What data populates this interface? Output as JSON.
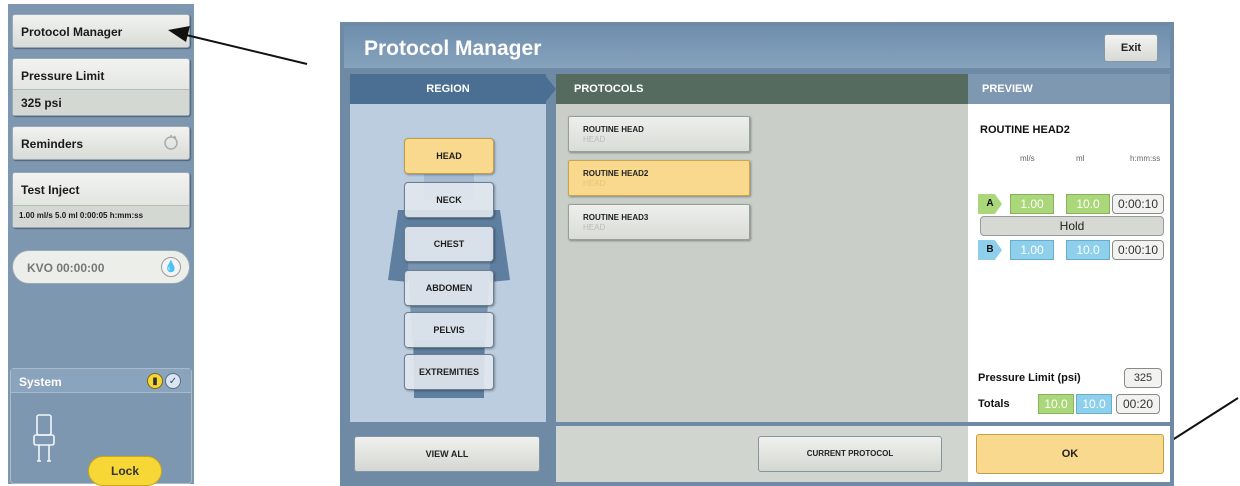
{
  "sidebar": {
    "protocol_manager_label": "Protocol Manager",
    "pressure_limit": {
      "label": "Pressure Limit",
      "value": "325 psi"
    },
    "reminders_label": "Reminders",
    "test_inject": {
      "label": "Test Inject",
      "value": "1.00 ml/s 5.0 ml 0:00:05 h:mm:ss"
    },
    "kvo_label": "KVO 00:00:00",
    "system_label": "System",
    "lock_label": "Lock"
  },
  "window": {
    "title": "Protocol Manager",
    "exit_label": "Exit"
  },
  "region": {
    "header": "REGION",
    "items": [
      "HEAD",
      "NECK",
      "CHEST",
      "ABDOMEN",
      "PELVIS",
      "EXTREMITIES"
    ],
    "selected": "HEAD",
    "view_all_label": "VIEW ALL"
  },
  "protocols": {
    "header": "PROTOCOLS",
    "items": [
      {
        "name": "ROUTINE HEAD",
        "region": "HEAD"
      },
      {
        "name": "ROUTINE HEAD2",
        "region": "HEAD"
      },
      {
        "name": "ROUTINE HEAD3",
        "region": "HEAD"
      }
    ],
    "selected": "ROUTINE HEAD2",
    "current_protocol_label": "CURRENT PROTOCOL"
  },
  "preview": {
    "header": "PREVIEW",
    "protocol_name": "ROUTINE HEAD2",
    "columns": [
      "ml/s",
      "ml",
      "h:mm:ss"
    ],
    "phases": [
      {
        "tag": "A",
        "rate": "1.00",
        "volume": "10.0",
        "duration": "0:00:10"
      },
      {
        "tag": "B",
        "rate": "1.00",
        "volume": "10.0",
        "duration": "0:00:10"
      }
    ],
    "hold_label": "Hold",
    "pressure_limit_label": "Pressure Limit (psi)",
    "pressure_limit_value": "325",
    "totals_label": "Totals",
    "totals": {
      "a": "10.0",
      "b": "10.0",
      "time": "00:20"
    },
    "ok_label": "OK"
  },
  "colors": {
    "selected": "#f8d98e",
    "phase_a": "#a9d779",
    "phase_b": "#8ed0ec",
    "lock": "#f7d735"
  }
}
